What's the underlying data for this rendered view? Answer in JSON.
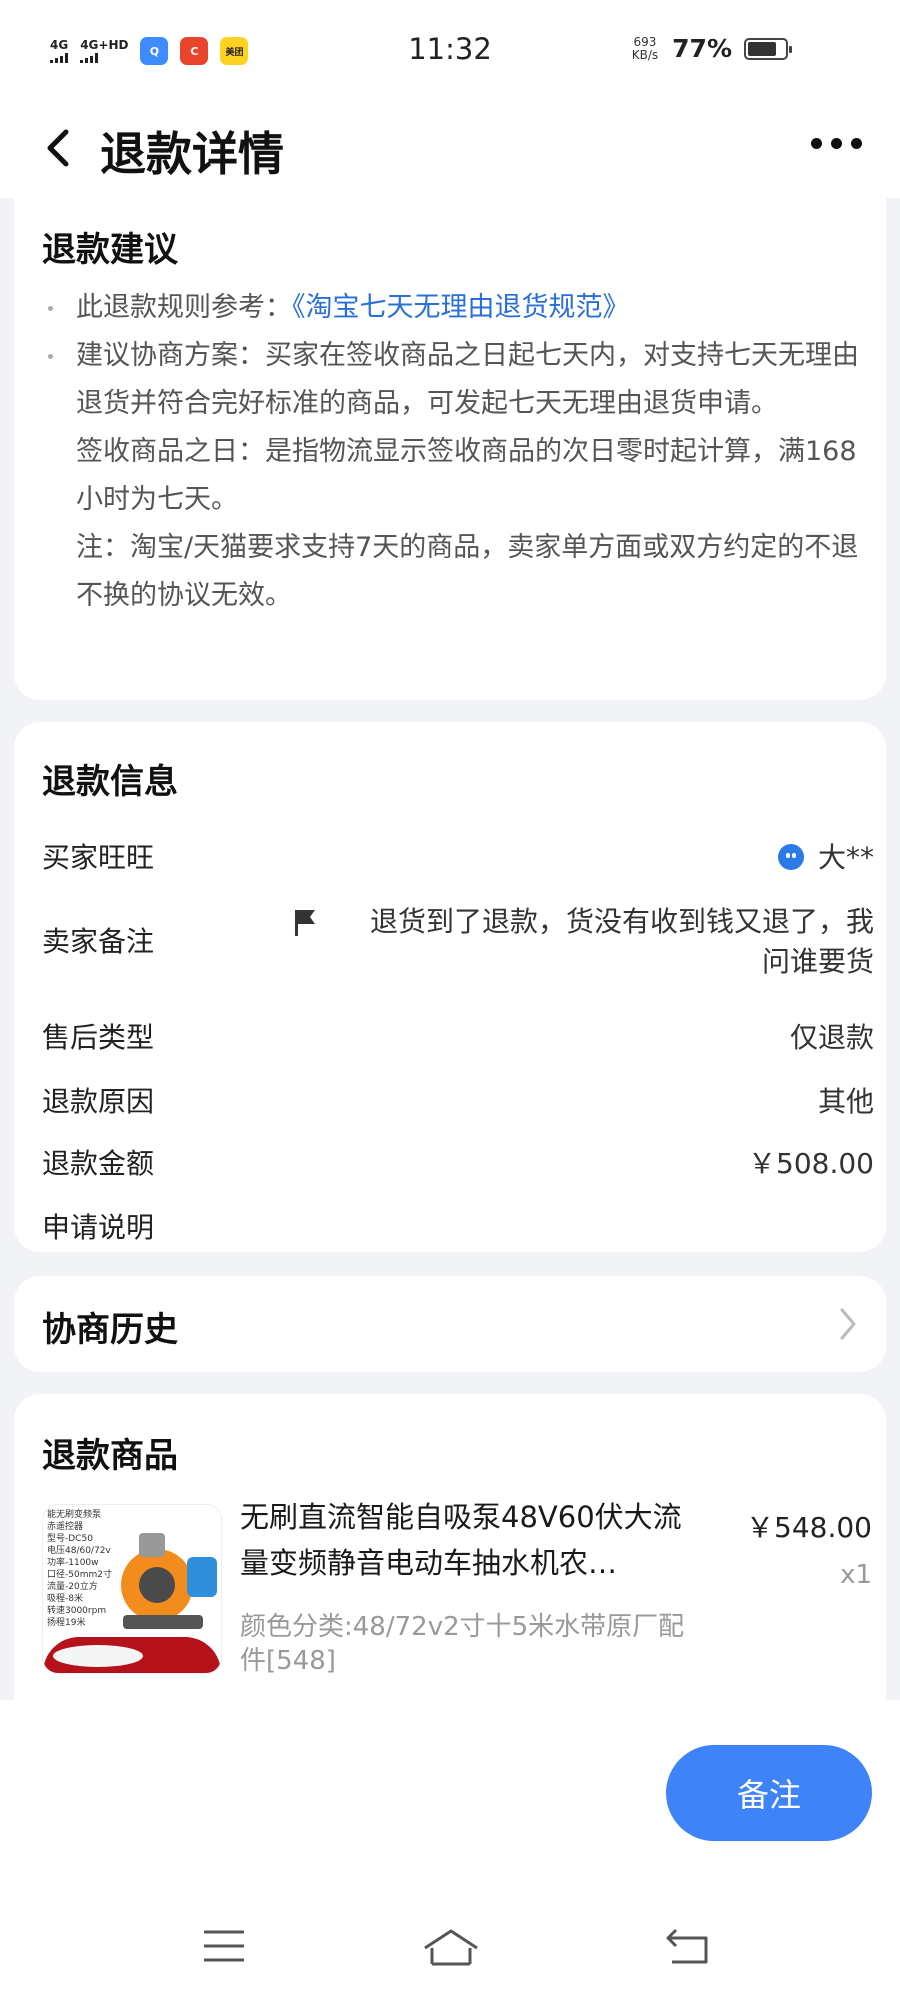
{
  "status_bar": {
    "network1": "4G",
    "network2": "4G+HD",
    "app_badges": [
      "Q",
      "C",
      "美团"
    ],
    "time": "11:32",
    "speed_value": "693",
    "speed_unit": "KB/s",
    "battery": "77%",
    "battery_level": 0.77
  },
  "nav": {
    "title": "退款详情"
  },
  "advice": {
    "title": "退款建议",
    "items": [
      {
        "prefix": "此退款规则参考：",
        "link": "《淘宝七天无理由退货规范》"
      },
      {
        "text": "建议协商方案：买家在签收商品之日起七天内，对支持七天无理由退货并符合完好标准的商品，可发起七天无理由退货申请。"
      }
    ],
    "extra": [
      "签收商品之日：是指物流显示签收商品的次日零时起计算，满168小时为七天。",
      "注：淘宝/天猫要求支持7天的商品，卖家单方面或双方约定的不退不换的协议无效。"
    ]
  },
  "info": {
    "title": "退款信息",
    "buyer_label": "买家旺旺",
    "buyer_value": "大**",
    "seller_note_label": "卖家备注",
    "seller_note_value": "退货到了退款，货没有收到钱又退了，我问谁要货",
    "type_label": "售后类型",
    "type_value": "仅退款",
    "reason_label": "退款原因",
    "reason_value": "其他",
    "amount_label": "退款金额",
    "amount_value": "￥508.00",
    "desc_label": "申请说明",
    "desc_value": ""
  },
  "history": {
    "title": "协商历史"
  },
  "goods": {
    "title": "退款商品",
    "name": "无刷直流智能自吸泵48V60伏大流量变频静音电动车抽水机农…",
    "spec": "颜色分类:48/72v2寸十5米水带原厂配件[548]",
    "price": "￥548.00",
    "qty": "x1",
    "thumb_lines": [
      "能无刷变频泵",
      "赤遥控器",
      "型号-DC50",
      "电压48/60/72v",
      "功率-1100w",
      "口径-50mm2寸",
      "流量-20立方",
      "吸程-8米",
      "转速3000rpm",
      "扬程19米"
    ]
  },
  "actions": {
    "remark": "备注"
  }
}
